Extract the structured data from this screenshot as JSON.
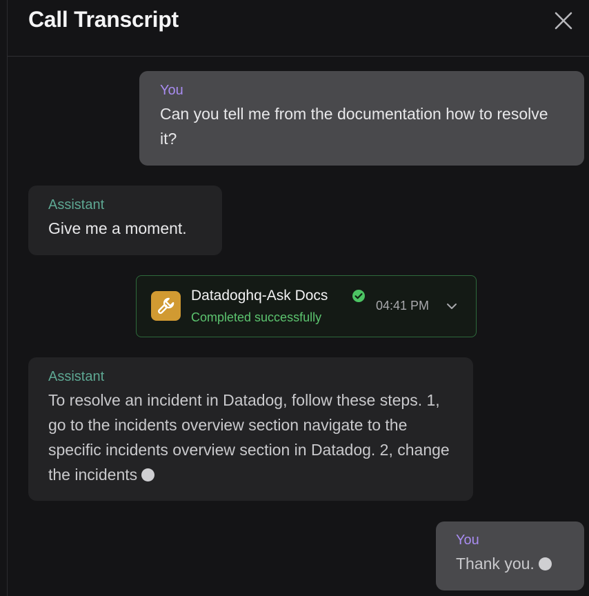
{
  "header": {
    "title": "Call Transcript",
    "close_icon": "close-icon"
  },
  "messages": [
    {
      "role": "user",
      "speaker": "You",
      "text": "Can you tell me from the documentation how to resolve it?"
    },
    {
      "role": "assistant",
      "speaker": "Assistant",
      "text": "Give me a moment."
    },
    {
      "role": "assistant",
      "speaker": "Assistant",
      "text": "To resolve an incident in Datadog, follow these steps. 1, go to the incidents overview section navigate to the specific incidents overview section in Datadog. 2, change the incidents",
      "streaming": true
    },
    {
      "role": "user",
      "speaker": "You",
      "text": "Thank you.",
      "streaming": true
    }
  ],
  "tool_call": {
    "name": "Datadoghq-Ask Docs",
    "status": "Completed successfully",
    "time": "04:41 PM",
    "icon": "wrench-icon",
    "status_icon": "check-circle-icon",
    "expand_icon": "chevron-down-icon"
  },
  "colors": {
    "background": "#141416",
    "user_bubble": "#49494c",
    "assistant_bubble": "#232325",
    "user_speaker": "#a88cf0",
    "assistant_speaker": "#5ea893",
    "tool_border": "#2e6a3c",
    "tool_status": "#5cc46f",
    "tool_icon_bg": "#d19a32"
  }
}
